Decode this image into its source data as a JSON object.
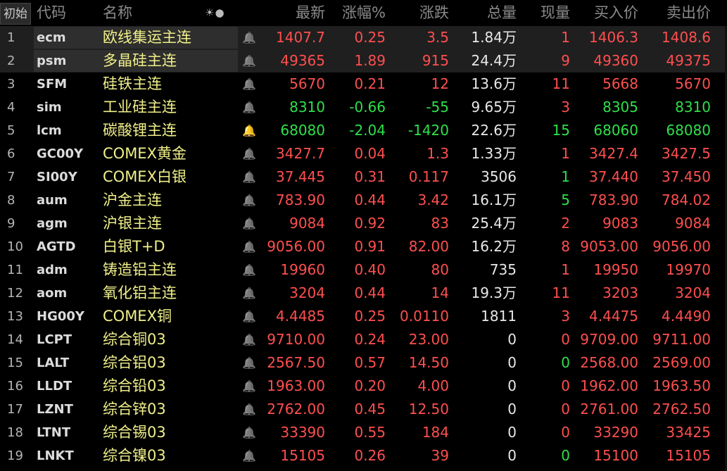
{
  "header": {
    "init_label": "初始",
    "icons": "☀●",
    "col_code": "代码",
    "col_name": "名称",
    "col_last": "最新",
    "col_change_pct": "涨幅%",
    "col_change": "涨跌",
    "col_volume": "总量",
    "col_current": "现量",
    "col_bid": "买入价",
    "col_ask": "卖出价"
  },
  "colors": {
    "up": "#ff4f4f",
    "down": "#2ee04a",
    "flat": "#e8e8e8",
    "name": "#f0f08a",
    "alert_bell": "#ff4a2a"
  },
  "rows": [
    {
      "idx": "1",
      "code": "ecm",
      "name": "欧线集运主连",
      "alert": false,
      "last": "1407.7",
      "pct": "0.25",
      "chg": "3.5",
      "vol": "1.84",
      "vol_unit": "万",
      "cur": "1",
      "bid": "1406.3",
      "ask": "1408.6",
      "dir": "up",
      "cur_dir": "up",
      "sel": true
    },
    {
      "idx": "2",
      "code": "psm",
      "name": "多晶硅主连",
      "alert": false,
      "last": "49365",
      "pct": "1.89",
      "chg": "915",
      "vol": "24.4",
      "vol_unit": "万",
      "cur": "9",
      "bid": "49360",
      "ask": "49375",
      "dir": "up",
      "cur_dir": "up",
      "sel": true
    },
    {
      "idx": "3",
      "code": "SFM",
      "name": "硅铁主连",
      "alert": false,
      "last": "5670",
      "pct": "0.21",
      "chg": "12",
      "vol": "13.6",
      "vol_unit": "万",
      "cur": "11",
      "bid": "5668",
      "ask": "5670",
      "dir": "up",
      "cur_dir": "up"
    },
    {
      "idx": "4",
      "code": "sim",
      "name": "工业硅主连",
      "alert": false,
      "last": "8310",
      "pct": "-0.66",
      "chg": "-55",
      "vol": "9.65",
      "vol_unit": "万",
      "cur": "3",
      "bid": "8305",
      "ask": "8310",
      "dir": "down",
      "cur_dir": "up"
    },
    {
      "idx": "5",
      "code": "lcm",
      "name": "碳酸锂主连",
      "alert": true,
      "last": "68080",
      "pct": "-2.04",
      "chg": "-1420",
      "vol": "22.6",
      "vol_unit": "万",
      "cur": "15",
      "bid": "68060",
      "ask": "68080",
      "dir": "down",
      "cur_dir": "down"
    },
    {
      "idx": "6",
      "code": "GC00Y",
      "name": "COMEX黄金",
      "alert": false,
      "last": "3427.7",
      "pct": "0.04",
      "chg": "1.3",
      "vol": "1.33",
      "vol_unit": "万",
      "cur": "1",
      "bid": "3427.4",
      "ask": "3427.5",
      "dir": "up",
      "cur_dir": "up"
    },
    {
      "idx": "7",
      "code": "SI00Y",
      "name": "COMEX白银",
      "alert": false,
      "last": "37.445",
      "pct": "0.31",
      "chg": "0.117",
      "vol": "3506",
      "vol_unit": "",
      "cur": "1",
      "bid": "37.440",
      "ask": "37.450",
      "dir": "up",
      "cur_dir": "down"
    },
    {
      "idx": "8",
      "code": "aum",
      "name": "沪金主连",
      "alert": false,
      "last": "783.90",
      "pct": "0.44",
      "chg": "3.42",
      "vol": "16.1",
      "vol_unit": "万",
      "cur": "5",
      "bid": "783.90",
      "ask": "784.02",
      "dir": "up",
      "cur_dir": "down"
    },
    {
      "idx": "9",
      "code": "agm",
      "name": "沪银主连",
      "alert": false,
      "last": "9084",
      "pct": "0.92",
      "chg": "83",
      "vol": "25.4",
      "vol_unit": "万",
      "cur": "2",
      "bid": "9083",
      "ask": "9084",
      "dir": "up",
      "cur_dir": "up"
    },
    {
      "idx": "10",
      "code": "AGTD",
      "name": "白银T+D",
      "alert": false,
      "last": "9056.00",
      "pct": "0.91",
      "chg": "82.00",
      "vol": "16.2",
      "vol_unit": "万",
      "cur": "8",
      "bid": "9053.00",
      "ask": "9056.00",
      "dir": "up",
      "cur_dir": "up"
    },
    {
      "idx": "11",
      "code": "adm",
      "name": "铸造铝主连",
      "alert": false,
      "last": "19960",
      "pct": "0.40",
      "chg": "80",
      "vol": "735",
      "vol_unit": "",
      "cur": "1",
      "bid": "19950",
      "ask": "19970",
      "dir": "up",
      "cur_dir": "up"
    },
    {
      "idx": "12",
      "code": "aom",
      "name": "氧化铝主连",
      "alert": false,
      "last": "3204",
      "pct": "0.44",
      "chg": "14",
      "vol": "19.3",
      "vol_unit": "万",
      "cur": "11",
      "bid": "3203",
      "ask": "3204",
      "dir": "up",
      "cur_dir": "up"
    },
    {
      "idx": "13",
      "code": "HG00Y",
      "name": "COMEX铜",
      "alert": false,
      "last": "4.4485",
      "pct": "0.25",
      "chg": "0.0110",
      "vol": "1811",
      "vol_unit": "",
      "cur": "3",
      "bid": "4.4475",
      "ask": "4.4490",
      "dir": "up",
      "cur_dir": "up"
    },
    {
      "idx": "14",
      "code": "LCPT",
      "name": "综合铜03",
      "alert": false,
      "last": "9710.00",
      "pct": "0.24",
      "chg": "23.00",
      "vol": "0",
      "vol_unit": "",
      "cur": "0",
      "bid": "9709.00",
      "ask": "9711.00",
      "dir": "up",
      "cur_dir": "up"
    },
    {
      "idx": "15",
      "code": "LALT",
      "name": "综合铝03",
      "alert": false,
      "last": "2567.50",
      "pct": "0.57",
      "chg": "14.50",
      "vol": "0",
      "vol_unit": "",
      "cur": "0",
      "bid": "2568.00",
      "ask": "2569.00",
      "dir": "up",
      "cur_dir": "down"
    },
    {
      "idx": "16",
      "code": "LLDT",
      "name": "综合铅03",
      "alert": false,
      "last": "1963.00",
      "pct": "0.20",
      "chg": "4.00",
      "vol": "0",
      "vol_unit": "",
      "cur": "0",
      "bid": "1962.00",
      "ask": "1963.50",
      "dir": "up",
      "cur_dir": "up"
    },
    {
      "idx": "17",
      "code": "LZNT",
      "name": "综合锌03",
      "alert": false,
      "last": "2762.00",
      "pct": "0.45",
      "chg": "12.50",
      "vol": "0",
      "vol_unit": "",
      "cur": "0",
      "bid": "2761.00",
      "ask": "2762.50",
      "dir": "up",
      "cur_dir": "up"
    },
    {
      "idx": "18",
      "code": "LTNT",
      "name": "综合锡03",
      "alert": false,
      "last": "33390",
      "pct": "0.55",
      "chg": "184",
      "vol": "0",
      "vol_unit": "",
      "cur": "0",
      "bid": "33290",
      "ask": "33425",
      "dir": "up",
      "cur_dir": "up"
    },
    {
      "idx": "19",
      "code": "LNKT",
      "name": "综合镍03",
      "alert": false,
      "last": "15105",
      "pct": "0.26",
      "chg": "39",
      "vol": "0",
      "vol_unit": "",
      "cur": "0",
      "bid": "15100",
      "ask": "15105",
      "dir": "up",
      "cur_dir": "down"
    }
  ]
}
